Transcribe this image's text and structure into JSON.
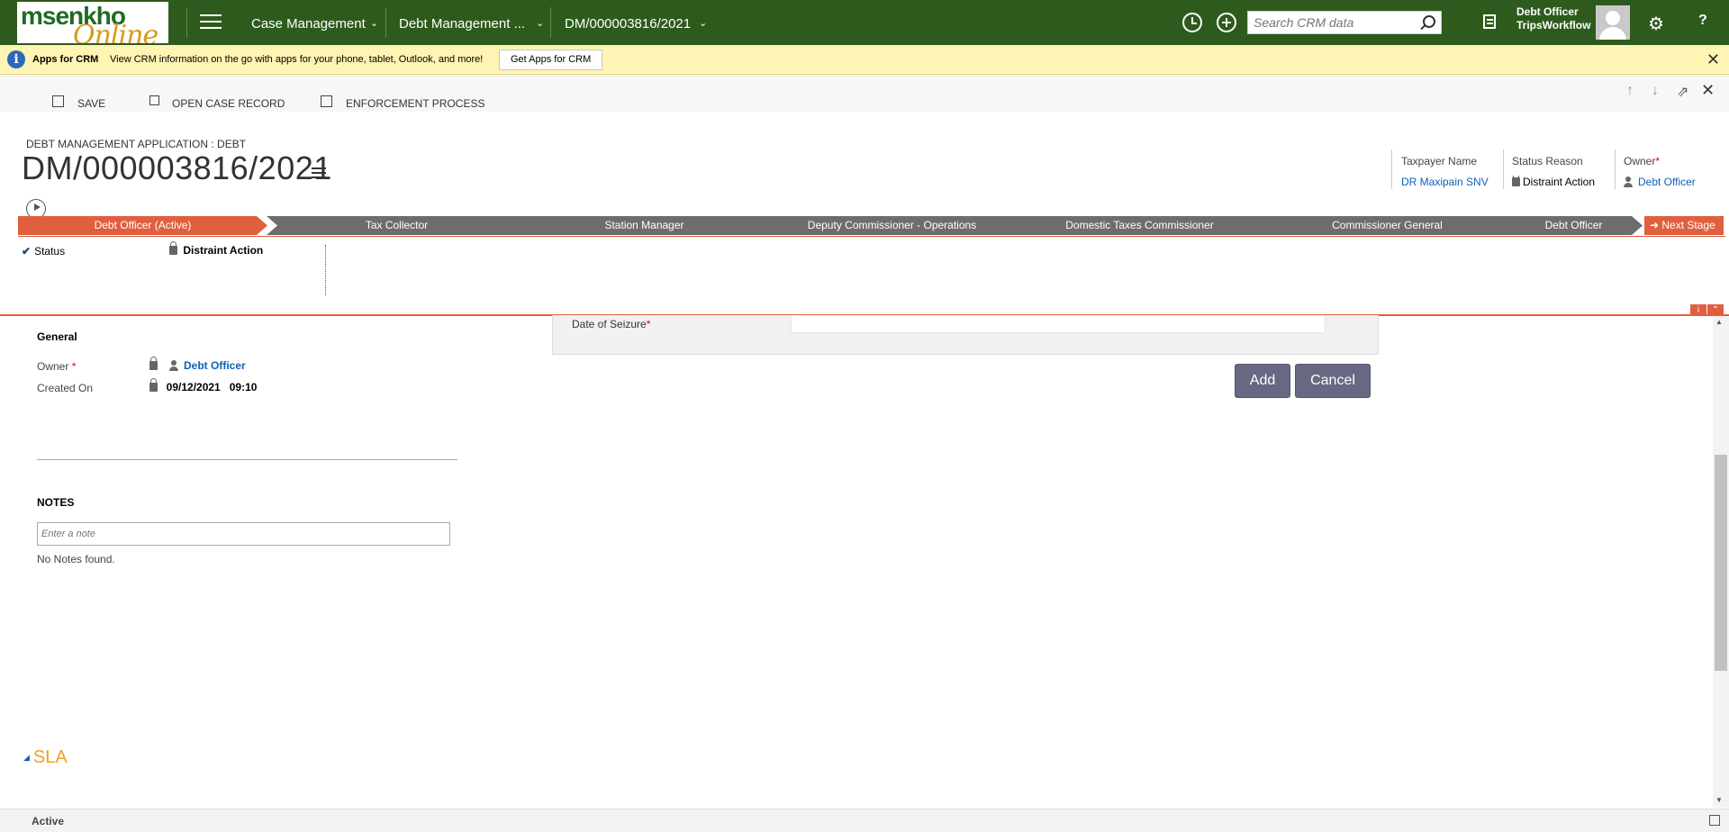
{
  "logo": {
    "line1": "msenkho",
    "line2": "Online"
  },
  "nav": {
    "items": [
      {
        "label": "Case Management"
      },
      {
        "label": "Debt Management ..."
      },
      {
        "label": "DM/000003816/2021"
      }
    ],
    "search_placeholder": "Search CRM data",
    "user_name": "Debt Officer",
    "user_org": "TripsWorkflow",
    "help": "?"
  },
  "notification": {
    "title": "Apps for CRM",
    "message": "View CRM information on the go with apps for your phone, tablet, Outlook, and more!",
    "button": "Get Apps for CRM"
  },
  "commands": {
    "save": "SAVE",
    "open_case": "OPEN CASE RECORD",
    "enforcement": "ENFORCEMENT PROCESS"
  },
  "header": {
    "entity_type": "DEBT MANAGEMENT APPLICATION : DEBT",
    "title": "DM/000003816/2021",
    "fields": [
      {
        "label": "Taxpayer Name",
        "value": "DR Maxipain SNV"
      },
      {
        "label": "Status Reason",
        "value": "Distraint Action"
      },
      {
        "label": "Owner",
        "value": "Debt Officer"
      }
    ]
  },
  "process": {
    "stages": [
      "Debt Officer (Active)",
      "Tax Collector",
      "Station Manager",
      "Deputy Commissioner - Operations",
      "Domestic Taxes Commissioner",
      "Commissioner General",
      "Debt Officer"
    ],
    "next_stage": "Next Stage",
    "step_label": "Status",
    "step_value": "Distraint Action"
  },
  "general": {
    "title": "General",
    "owner_label": "Owner",
    "owner_value": "Debt Officer",
    "created_label": "Created On",
    "created_date": "09/12/2021",
    "created_time": "09:10"
  },
  "notes": {
    "title": "NOTES",
    "placeholder": "Enter a note",
    "empty": "No Notes found."
  },
  "dialog": {
    "date_label": "Date of Seizure",
    "add": "Add",
    "cancel": "Cancel"
  },
  "sla": {
    "title": "SLA"
  },
  "footer": {
    "status": "Active"
  },
  "colors": {
    "nav_bg": "#2e5b1d",
    "accent": "#e05f3f",
    "stage_gray": "#6d6d6d",
    "link": "#1160b7",
    "button": "#686883",
    "notify_bg": "#fff4b3"
  }
}
